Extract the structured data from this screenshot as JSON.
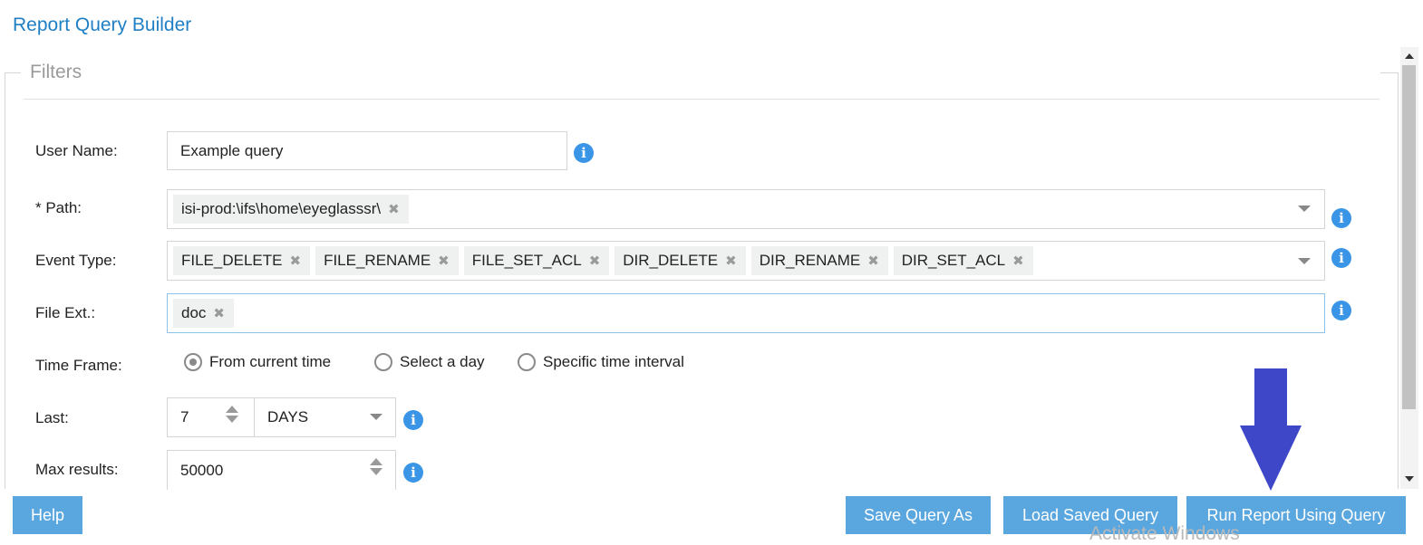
{
  "header": {
    "title": "Report Query Builder"
  },
  "filters": {
    "legend": "Filters",
    "user_name": {
      "label": "User Name:",
      "value": "Example query"
    },
    "path": {
      "label": "* Path:",
      "tags": [
        "isi-prod:\\ifs\\home\\eyeglasssr\\"
      ]
    },
    "event_type": {
      "label": "Event Type:",
      "tags": [
        "FILE_DELETE",
        "FILE_RENAME",
        "FILE_SET_ACL",
        "DIR_DELETE",
        "DIR_RENAME",
        "DIR_SET_ACL"
      ]
    },
    "file_ext": {
      "label": "File Ext.:",
      "tags": [
        "doc"
      ]
    },
    "time_frame": {
      "label": "Time Frame:",
      "options": [
        "From current time",
        "Select a day",
        "Specific time interval"
      ],
      "selected": "From current time"
    },
    "last": {
      "label": "Last:",
      "value": "7",
      "unit": "DAYS"
    },
    "max_results": {
      "label": "Max results:",
      "value": "50000"
    },
    "tag_remove_glyph": "✖",
    "info_glyph": "i"
  },
  "buttons": {
    "help": "Help",
    "save_query_as": "Save Query As",
    "load_saved_query": "Load Saved Query",
    "run_report": "Run Report Using Query"
  },
  "overlay": {
    "watermark": "Activate Windows",
    "arrow_color": "#3d47c8"
  },
  "colors": {
    "accent": "#1f7fc4",
    "button": "#5aa6df",
    "info": "#3a95e6"
  }
}
